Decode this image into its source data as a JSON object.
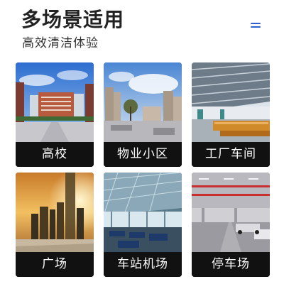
{
  "header": {
    "title": "多场景适用",
    "subtitle": "高效清洁体验",
    "accent_color": "#2f5fd0",
    "menu_icon": "menu-icon"
  },
  "scenes": [
    {
      "label": "高校"
    },
    {
      "label": "物业小区"
    },
    {
      "label": "工厂车间"
    },
    {
      "label": "广场"
    },
    {
      "label": "车站机场"
    },
    {
      "label": "停车场"
    }
  ]
}
